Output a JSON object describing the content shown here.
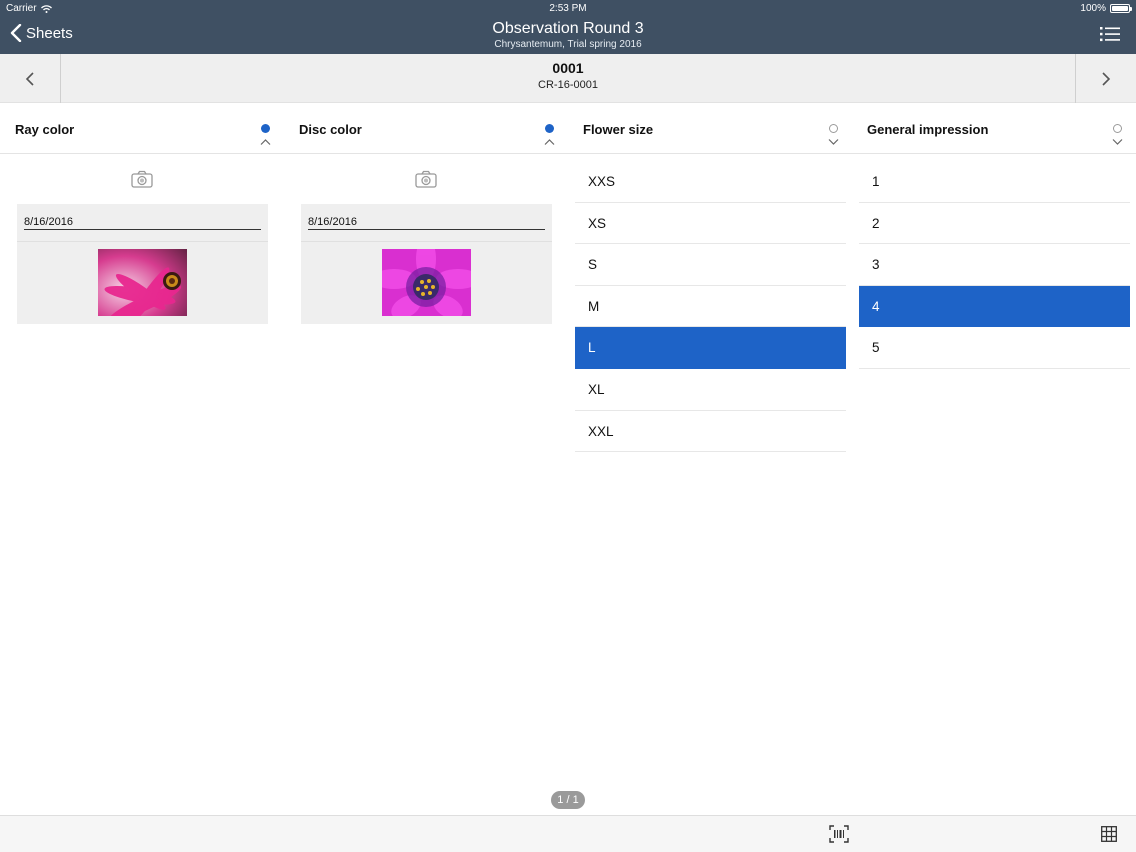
{
  "status": {
    "carrier": "Carrier",
    "time": "2:53 PM",
    "battery": "100%"
  },
  "nav": {
    "back_label": "Sheets",
    "title": "Observation Round 3",
    "subtitle": "Chrysantemum, Trial spring 2016"
  },
  "record": {
    "id": "0001",
    "code": "CR-16-0001"
  },
  "columns": [
    {
      "title": "Ray color",
      "status": "filled",
      "chevron": "chevron-up",
      "photo_date": "8/16/2016"
    },
    {
      "title": "Disc color",
      "status": "filled",
      "chevron": "chevron-up",
      "photo_date": "8/16/2016"
    },
    {
      "title": "Flower size",
      "status": "empty",
      "chevron": "chevron-down",
      "options": [
        "XXS",
        "XS",
        "S",
        "M",
        "L",
        "XL",
        "XXL"
      ],
      "selected": "L"
    },
    {
      "title": "General impression",
      "status": "empty",
      "chevron": "chevron-down",
      "options": [
        "1",
        "2",
        "3",
        "4",
        "5"
      ],
      "selected": "4"
    }
  ],
  "pager": "1 / 1",
  "colors": {
    "nav_bg": "#3f5063",
    "accent": "#1e63c7"
  },
  "icons": [
    "wifi-icon",
    "battery-icon",
    "chevron-left-icon",
    "list-menu-icon",
    "chevron-right-icon",
    "camera-icon",
    "barcode-icon",
    "grid-icon"
  ]
}
